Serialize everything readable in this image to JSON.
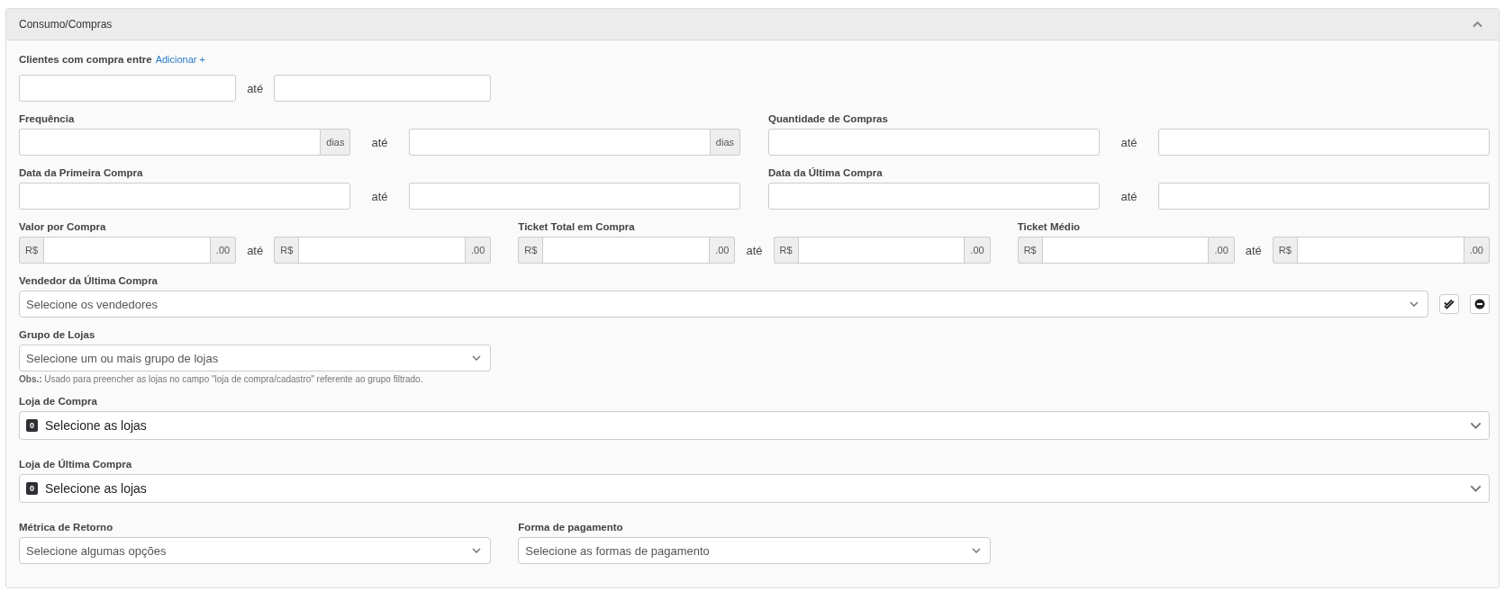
{
  "panel": {
    "title": "Consumo/Compras",
    "expanded": true
  },
  "purchase_between": {
    "label": "Clientes com compra entre",
    "link": "Adicionar +",
    "separator": "até"
  },
  "frequency": {
    "label": "Frequência",
    "from": {
      "suffix": "dias"
    },
    "separator": "até",
    "to": {
      "suffix": "dias"
    }
  },
  "purchase_count": {
    "label": "Quantidade de Compras",
    "separator": "até"
  },
  "first_purchase_date": {
    "label": "Data da Primeira Compra",
    "separator": "até"
  },
  "last_purchase_date": {
    "label": "Data da Última Compra",
    "separator": "até"
  },
  "value_per_purchase": {
    "label": "Valor por Compra",
    "from": {
      "prefix": "R$",
      "suffix": ".00"
    },
    "separator": "até",
    "to": {
      "prefix": "R$",
      "suffix": ".00"
    }
  },
  "total_ticket": {
    "label": "Ticket Total em Compra",
    "from": {
      "prefix": "R$",
      "suffix": ".00"
    },
    "separator": "até",
    "to": {
      "prefix": "R$",
      "suffix": ".00"
    }
  },
  "average_ticket": {
    "label": "Ticket Médio",
    "from": {
      "prefix": "R$",
      "suffix": ".00"
    },
    "separator": "até",
    "to": {
      "prefix": "R$",
      "suffix": ".00"
    }
  },
  "last_seller": {
    "label": "Vendedor da Última Compra",
    "placeholder": "Selecione os vendedores"
  },
  "store_group": {
    "label": "Grupo de Lojas",
    "placeholder": "Selecione um ou mais grupo de lojas",
    "note": "**Obs.:** Usado para preencher as lojas no campo \"loja de compra/cadastro\" referente ao grupo filtrado."
  },
  "purchase_store": {
    "label": "Loja de Compra",
    "count": "0",
    "placeholder": "Selecione as lojas"
  },
  "last_purchase_store": {
    "label": "Loja de Última Compra",
    "count": "0",
    "placeholder": "Selecione as lojas"
  },
  "return_metric": {
    "label": "Métrica de Retorno",
    "placeholder": "Selecione algumas opções"
  },
  "payment_method": {
    "label": "Forma de pagamento",
    "placeholder": "Selecione as formas de pagamento"
  }
}
